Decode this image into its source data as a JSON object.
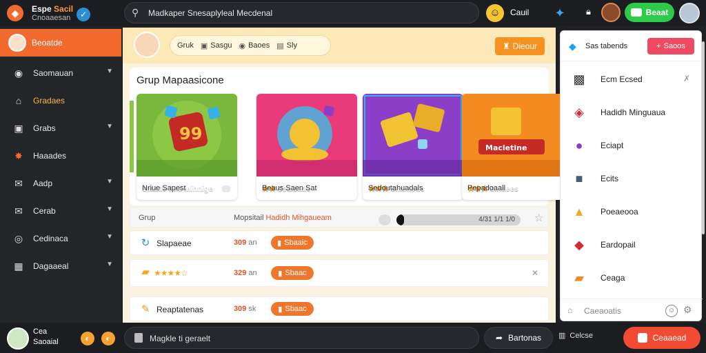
{
  "brand": {
    "title_a": "Espe",
    "title_b": "Sacil",
    "subtitle": "Cnoaaesan"
  },
  "search": {
    "value": "Madkaper Snesaplyleal Mecdenal"
  },
  "topbar": {
    "label": "Cauil",
    "button": "Beaat"
  },
  "sidebar": {
    "items": [
      {
        "label": "Beoatde"
      },
      {
        "label": "Saomauan"
      },
      {
        "label": "Gradaes"
      },
      {
        "label": "Grabs"
      },
      {
        "label": "Haaades"
      },
      {
        "label": "Aadp"
      },
      {
        "label": "Cerab"
      },
      {
        "label": "Cedinaca"
      },
      {
        "label": "Dagaaeal"
      }
    ]
  },
  "header": {
    "tabs": [
      {
        "label": "Gruk"
      },
      {
        "label": "Sasgu"
      },
      {
        "label": "Baoes"
      },
      {
        "label": "Sly"
      }
    ],
    "button": "Dieour"
  },
  "panel": {
    "title": "Grup Mapaasicone",
    "cards": [
      {
        "caption": "Staade fike Mihnige",
        "subtitle": "Nriue Sapest",
        "color": "#7ab83d"
      },
      {
        "caption": "Seaicade",
        "subtitle": "Beaus Saen Sat",
        "color": "#e93a7a"
      },
      {
        "caption": "Snainods",
        "subtitle": "Sedoutahuadals",
        "color": "#8b3fc9"
      },
      {
        "caption": "Sinaees",
        "subtitle": "Pepadoaall",
        "color": "#f48b21"
      }
    ]
  },
  "list": {
    "header": {
      "col1": "Grup",
      "col2a": "Mopsitail",
      "col2b": "Hadidh Mihgaueam",
      "progress_label": "4/31 1/1 1/0",
      "progress": 0.06
    },
    "rows": [
      {
        "label": "Slapaeae",
        "price": "309",
        "unit": "an",
        "button": "Sbaaic"
      },
      {
        "label": "",
        "price": "329",
        "unit": "an",
        "button": "Sbaac",
        "stars": "★★★★☆"
      },
      {
        "label": "Reaptatenas",
        "price": "309",
        "unit": "sk",
        "button": "Sbaac"
      }
    ]
  },
  "right_panel": {
    "title": "Sas tabends",
    "button": "Saoos",
    "items": [
      {
        "label": "Ecm Ecsed"
      },
      {
        "label": "Hadidh Minguaua"
      },
      {
        "label": "Eciapt"
      },
      {
        "label": "Ecits"
      },
      {
        "label": "Poeaeooa"
      },
      {
        "label": "Eardopail"
      },
      {
        "label": "Ceaga"
      }
    ],
    "footer": "Caeaoatis"
  },
  "bottombar": {
    "name1": "Cea",
    "name2": "Saoaial",
    "input": "Magkle ti geraelt",
    "btn1": "Bartonas",
    "btn2": "Celcse",
    "btn3": "Ceaaead"
  }
}
